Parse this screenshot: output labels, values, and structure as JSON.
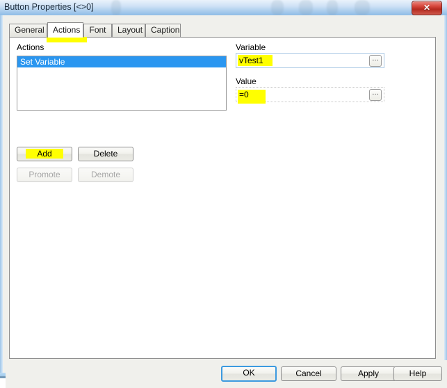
{
  "window": {
    "title": "Button Properties [<>0]",
    "close_label": "✕",
    "close_icon": "close-icon"
  },
  "tabs": [
    {
      "label": "General",
      "active": false
    },
    {
      "label": "Actions",
      "active": true
    },
    {
      "label": "Font",
      "active": false
    },
    {
      "label": "Layout",
      "active": false
    },
    {
      "label": "Caption",
      "active": false
    }
  ],
  "actions_panel": {
    "list_label": "Actions",
    "list_items": [
      {
        "label": "Set Variable",
        "selected": true
      }
    ],
    "buttons": {
      "add": "Add",
      "delete": "Delete",
      "promote": "Promote",
      "demote": "Demote"
    },
    "variable": {
      "label": "Variable",
      "value": "vTest1",
      "browse_label": "…"
    },
    "value": {
      "label": "Value",
      "value": "=0",
      "browse_label": "…"
    }
  },
  "footer": {
    "ok": "OK",
    "cancel": "Cancel",
    "apply": "Apply",
    "help": "Help"
  },
  "colors": {
    "selection_blue": "#2a96f0",
    "highlight_yellow": "#ffff00",
    "focus_blue": "#3c9ae0",
    "close_red": "#b52a1f",
    "dialog_gray": "#f0f0ec"
  }
}
